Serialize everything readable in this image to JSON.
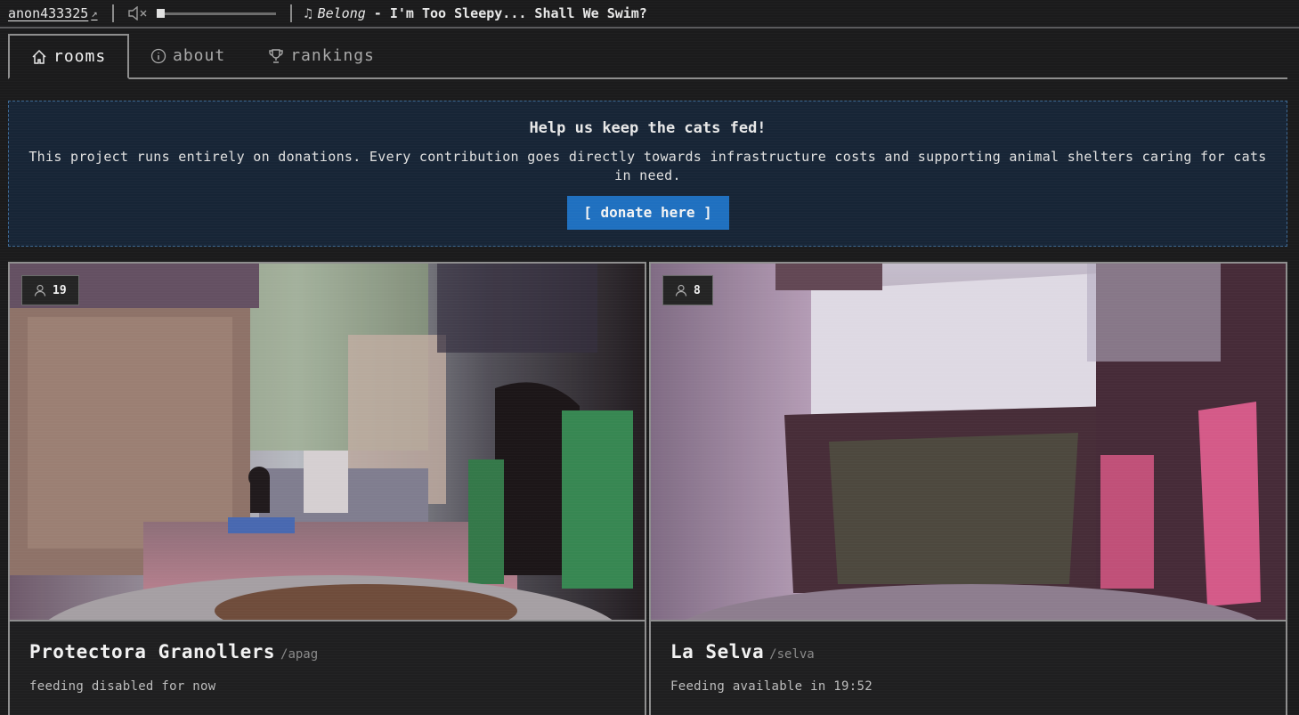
{
  "topbar": {
    "username": "anon433325",
    "user_link_icon": "external-link-icon",
    "mute_icon": "speaker-muted-icon",
    "volume_level": 0.0,
    "music_icon": "music-note-icon",
    "now_playing_song": "Belong",
    "now_playing_rest": " - I'm Too Sleepy...  Shall We Swim?"
  },
  "tabs": [
    {
      "label": "rooms",
      "icon": "home-icon",
      "active": true
    },
    {
      "label": "about",
      "icon": "info-icon",
      "active": false
    },
    {
      "label": "rankings",
      "icon": "trophy-icon",
      "active": false
    }
  ],
  "banner": {
    "title": "Help us keep the cats fed!",
    "text": "This project runs entirely on donations. Every contribution goes directly towards infrastructure costs and supporting animal shelters caring for cats in need.",
    "button": "[ donate here ]"
  },
  "rooms": [
    {
      "name": "Protectora Granollers",
      "slug": "/apag",
      "viewers": "19",
      "status": "feeding disabled for now"
    },
    {
      "name": "La Selva",
      "slug": "/selva",
      "viewers": "8",
      "status": "Feeding available in 19:52"
    }
  ],
  "colors": {
    "accent": "#1f70c0",
    "banner_bg": "#172536",
    "background": "#1b1b1c"
  }
}
